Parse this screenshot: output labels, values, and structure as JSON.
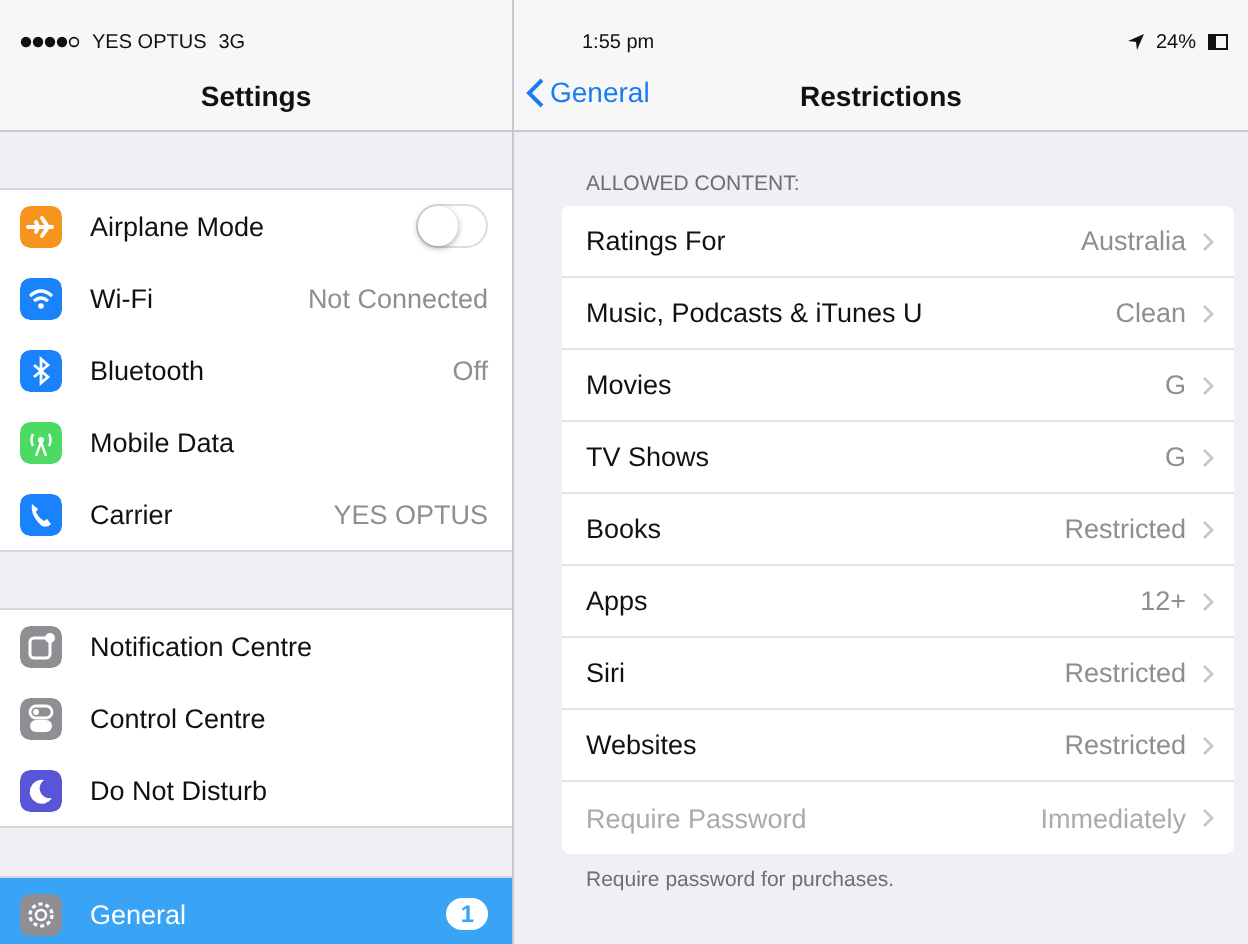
{
  "left_status_bar": {
    "carrier": "YES OPTUS",
    "network": "3G"
  },
  "sidebar": {
    "title": "Settings",
    "groups": [
      {
        "items": [
          {
            "label": "Airplane Mode",
            "kind": "toggle",
            "on": false,
            "selected": false,
            "color": "#f7941d"
          },
          {
            "label": "Wi-Fi",
            "kind": "value",
            "value": "Not Connected",
            "selected": false,
            "color": "#1a82fb"
          },
          {
            "label": "Bluetooth",
            "kind": "value",
            "value": "Off",
            "selected": false,
            "color": "#1a82fb"
          },
          {
            "label": "Mobile Data",
            "kind": "plain",
            "selected": false,
            "color": "#4cd964"
          },
          {
            "label": "Carrier",
            "kind": "value",
            "value": "YES OPTUS",
            "selected": false,
            "color": "#1a82fb"
          }
        ]
      },
      {
        "items": [
          {
            "label": "Notification Centre",
            "kind": "plain",
            "selected": false,
            "color": "#8e8e93"
          },
          {
            "label": "Control Centre",
            "kind": "plain",
            "selected": false,
            "color": "#8e8e93"
          },
          {
            "label": "Do Not Disturb",
            "kind": "plain",
            "selected": false,
            "color": "#5856d6"
          }
        ]
      },
      {
        "items": [
          {
            "label": "General",
            "kind": "badge",
            "badge": "1",
            "selected": true,
            "color": "#8e8e93"
          }
        ]
      }
    ]
  },
  "right_status_bar": {
    "time": "1:55 pm",
    "battery": "24%"
  },
  "nav": {
    "back": "General",
    "title": "Restrictions"
  },
  "section": {
    "header": "ALLOWED CONTENT:",
    "footer": "Require password for purchases.",
    "rows": [
      {
        "label": "Ratings For",
        "value": "Australia",
        "disabled": false
      },
      {
        "label": "Music, Podcasts & iTunes U",
        "value": "Clean",
        "disabled": false
      },
      {
        "label": "Movies",
        "value": "G",
        "disabled": false
      },
      {
        "label": "TV Shows",
        "value": "G",
        "disabled": false
      },
      {
        "label": "Books",
        "value": "Restricted",
        "disabled": false
      },
      {
        "label": "Apps",
        "value": "12+",
        "disabled": false
      },
      {
        "label": "Siri",
        "value": "Restricted",
        "disabled": false
      },
      {
        "label": "Websites",
        "value": "Restricted",
        "disabled": false
      },
      {
        "label": "Require Password",
        "value": "Immediately",
        "disabled": true
      }
    ]
  }
}
